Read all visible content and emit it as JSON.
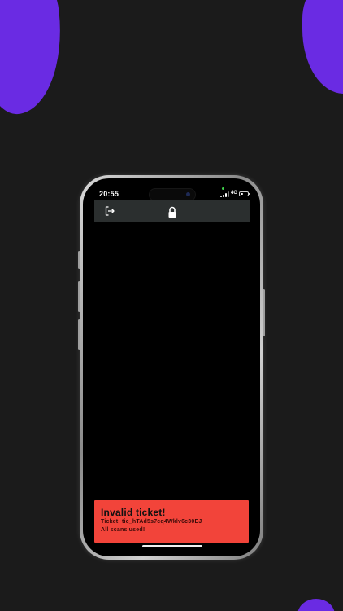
{
  "colors": {
    "background": "#1b1b1b",
    "accent_purple": "#6a2be3",
    "toast_background": "#f2443a",
    "header_background": "#2b2f2f"
  },
  "status_bar": {
    "time": "20:55",
    "network": "4G",
    "battery_level": 0.35
  },
  "header": {
    "left_icon": "logout-icon",
    "center_icon": "lock-icon"
  },
  "toast": {
    "title": "Invalid ticket!",
    "ticket_line": "Ticket: tic_hTAd5s7cq4Wklv6c30EJ",
    "status_line": "All scans used!"
  }
}
